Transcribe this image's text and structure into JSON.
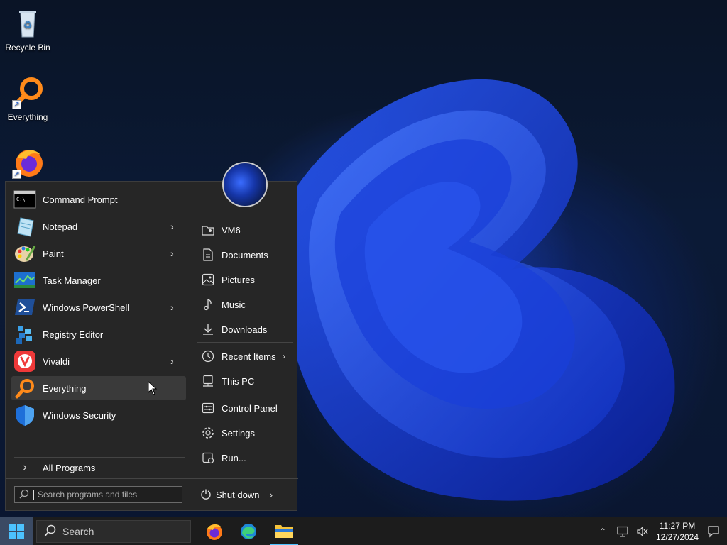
{
  "desktop": {
    "icons": [
      {
        "label": "Recycle Bin"
      },
      {
        "label": "Everything"
      },
      {
        "label": ""
      }
    ]
  },
  "start_menu": {
    "programs": [
      {
        "label": "Command Prompt",
        "submenu": false
      },
      {
        "label": "Notepad",
        "submenu": true
      },
      {
        "label": "Paint",
        "submenu": true
      },
      {
        "label": "Task Manager",
        "submenu": false
      },
      {
        "label": "Windows PowerShell",
        "submenu": true
      },
      {
        "label": "Registry Editor",
        "submenu": false
      },
      {
        "label": "Vivaldi",
        "submenu": true
      },
      {
        "label": "Everything",
        "submenu": false,
        "highlighted": true
      },
      {
        "label": "Windows Security",
        "submenu": false
      }
    ],
    "all_programs": "All Programs",
    "search_placeholder": "Search programs and files",
    "places": [
      {
        "label": "VM6"
      },
      {
        "label": "Documents"
      },
      {
        "label": "Pictures"
      },
      {
        "label": "Music"
      },
      {
        "label": "Downloads"
      },
      {
        "label": "Recent Items",
        "submenu": true
      },
      {
        "label": "This PC"
      },
      {
        "label": "Control Panel"
      },
      {
        "label": "Settings"
      },
      {
        "label": "Run..."
      }
    ],
    "shutdown": "Shut down"
  },
  "taskbar": {
    "search_label": "Search",
    "time": "11:27 PM",
    "date": "12/27/2024"
  },
  "colors": {
    "accent": "#1e6fd9",
    "menu_bg": "#262626",
    "taskbar_bg": "#1c1c1c"
  }
}
